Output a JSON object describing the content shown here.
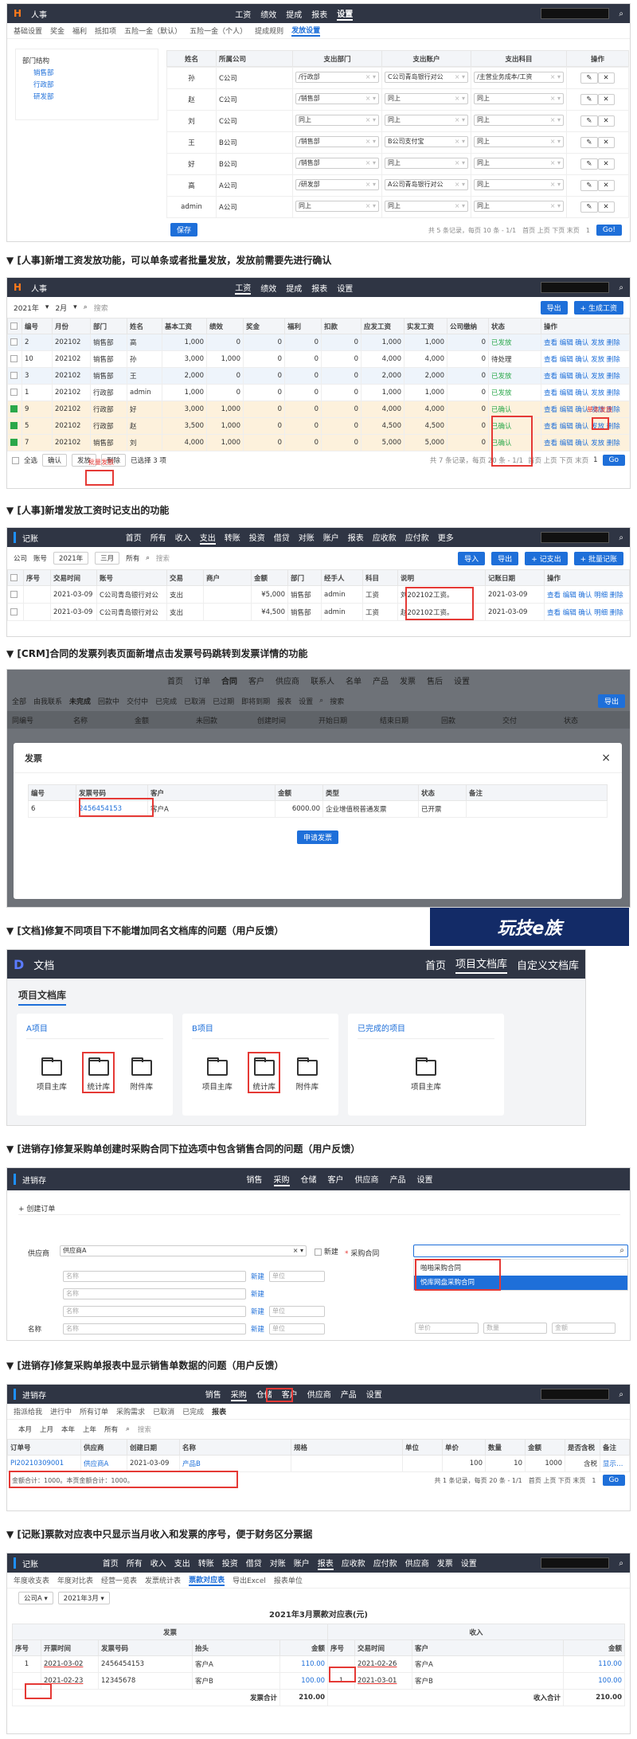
{
  "s1": {
    "logo": "H",
    "app": "人事",
    "nav": [
      "工资",
      "绩效",
      "提成",
      "报表",
      "设置"
    ],
    "nav_active": 4,
    "tabs": [
      "基础设置",
      "奖金",
      "福利",
      "抵扣项",
      "五险一金（默认）",
      "五险一金（个人）",
      "提成规则",
      "发放设置"
    ],
    "tab_active": 7,
    "tree_title": "部门结构",
    "tree": [
      "销售部",
      "行政部",
      "研发部"
    ],
    "cols": [
      "姓名",
      "所属公司",
      "支出部门",
      "支出账户",
      "支出科目",
      "操作"
    ],
    "rows": [
      [
        "孙",
        "C公司",
        "/行政部",
        "C公司青岛银行对公",
        "/主营业务成本/工资"
      ],
      [
        "赵",
        "C公司",
        "/销售部",
        "同上",
        "同上"
      ],
      [
        "刘",
        "C公司",
        "同上",
        "同上",
        "同上"
      ],
      [
        "王",
        "B公司",
        "/销售部",
        "B公司支付宝",
        "同上"
      ],
      [
        "好",
        "B公司",
        "/销售部",
        "同上",
        "同上"
      ],
      [
        "高",
        "A公司",
        "/研发部",
        "A公司青岛银行对公",
        "同上"
      ],
      [
        "admin",
        "A公司",
        "同上",
        "同上",
        "同上"
      ]
    ],
    "save": "保存",
    "pager": "共 5 条记录，每页 10 条 - 1/1",
    "pager2": "首页 上页 下页 末页",
    "page": "1",
    "go": "Go!"
  },
  "n1": "▼ [人事]新增工资发放功能，可以单条或者批量发放，发放前需要先进行确认",
  "s2": {
    "logo": "H",
    "app": "人事",
    "nav": [
      "工资",
      "绩效",
      "提成",
      "报表",
      "设置"
    ],
    "nav_active": 0,
    "year": "2021年",
    "month": "2月",
    "search": "搜索",
    "export": "导出",
    "gen": "+ 生成工资",
    "cols": [
      "编号",
      "月份",
      "部门",
      "姓名",
      "基本工资",
      "绩效",
      "奖金",
      "福利",
      "扣款",
      "应发工资",
      "实发工资",
      "公司缴纳",
      "状态",
      "操作"
    ],
    "rows": [
      [
        "2",
        "202102",
        "销售部",
        "高",
        "1,000",
        "0",
        "0",
        "0",
        "0",
        "1,000",
        "1,000",
        "0",
        "已发放"
      ],
      [
        "10",
        "202102",
        "销售部",
        "孙",
        "3,000",
        "1,000",
        "0",
        "0",
        "0",
        "4,000",
        "4,000",
        "0",
        "待处理"
      ],
      [
        "3",
        "202102",
        "销售部",
        "王",
        "2,000",
        "0",
        "0",
        "0",
        "0",
        "2,000",
        "2,000",
        "0",
        "已发放"
      ],
      [
        "1",
        "202102",
        "行政部",
        "admin",
        "1,000",
        "0",
        "0",
        "0",
        "0",
        "1,000",
        "1,000",
        "0",
        "已发放"
      ],
      [
        "9",
        "202102",
        "行政部",
        "好",
        "3,000",
        "1,000",
        "0",
        "0",
        "0",
        "4,000",
        "4,000",
        "0",
        "已确认"
      ],
      [
        "5",
        "202102",
        "行政部",
        "赵",
        "3,500",
        "1,000",
        "0",
        "0",
        "0",
        "4,500",
        "4,500",
        "0",
        "已确认"
      ],
      [
        "7",
        "202102",
        "销售部",
        "刘",
        "4,000",
        "1,000",
        "0",
        "0",
        "0",
        "5,000",
        "5,000",
        "0",
        "已确认"
      ]
    ],
    "ops": "查看 编辑 确认 发放 删除",
    "ops_paid": "查看 编辑 确认 发放 删除",
    "batch_all": "全选",
    "batch_confirm": "确认",
    "batch_pay": "发放",
    "batch_del": "删除",
    "selected": "已选择 3 项",
    "pay_note": "单条发放",
    "batch_note": "批量发放",
    "pager": "共 7 条记录，每页 20 条 - 1/1",
    "pager2": "首页 上页 下页 末页",
    "page": "1",
    "go": "Go"
  },
  "n2": "▼ [人事]新增发放工资时记支出的功能",
  "s3": {
    "app": "记账",
    "nav": [
      "首页",
      "所有",
      "收入",
      "支出",
      "转账",
      "投资",
      "借贷",
      "对账",
      "账户",
      "报表",
      "应收款",
      "应付款",
      "更多"
    ],
    "nav_active": 3,
    "filters": [
      "公司",
      "账号",
      "2021年",
      "三月",
      "所有"
    ],
    "search": "搜索",
    "import": "导入",
    "export": "导出",
    "add": "+ 记支出",
    "batch": "+ 批量记账",
    "cols": [
      "序号",
      "交易时间",
      "账号",
      "交易",
      "商户",
      "金额",
      "部门",
      "经手人",
      "科目",
      "说明",
      "记账日期",
      "操作"
    ],
    "rows": [
      [
        "2021-03-09",
        "C公司青岛银行对公",
        "支出",
        "",
        "¥5,000",
        "销售部",
        "admin",
        "工资",
        "刘202102工资。",
        "2021-03-09"
      ],
      [
        "2021-03-09",
        "C公司青岛银行对公",
        "支出",
        "",
        "¥4,500",
        "销售部",
        "admin",
        "工资",
        "赵202102工资。",
        "2021-03-09"
      ]
    ],
    "ops": "查看 编辑 确认 明细 删除"
  },
  "n3": "▼ [CRM]合同的发票列表页面新增点击发票号码跳转到发票详情的功能",
  "s4": {
    "nav": [
      "首页",
      "订单",
      "合同",
      "客户",
      "供应商",
      "联系人",
      "名单",
      "产品",
      "发票",
      "售后",
      "设置"
    ],
    "nav_active": 2,
    "filters": [
      "全部",
      "由我联系",
      "未完成",
      "回款中",
      "交付中",
      "已完成",
      "已取消",
      "已过期",
      "即将到期",
      "报表",
      "设置"
    ],
    "search": "搜索",
    "export": "导出",
    "bg_cols": [
      "同编号",
      "名称",
      "金额",
      "未回款",
      "创建时间",
      "开始日期",
      "结束日期",
      "回款",
      "交付",
      "状态"
    ],
    "modal_title": "发票",
    "mcols": [
      "编号",
      "发票号码",
      "客户",
      "金额",
      "类型",
      "状态",
      "备注"
    ],
    "mrow": [
      "6",
      "2456454153",
      "客户A",
      "6000.00",
      "企业增值税普通发票",
      "已开票",
      ""
    ],
    "apply": "申请发票"
  },
  "n4": "▼ [文档]修复不同项目下不能增加同名文档库的问题（用户反馈）",
  "banner": "玩技e族",
  "s5": {
    "app": "文档",
    "nav": [
      "首页",
      "项目文档库",
      "自定义文档库"
    ],
    "nav_active": 1,
    "title": "项目文档库",
    "cards": [
      {
        "name": "A项目",
        "libs": [
          "项目主库",
          "统计库",
          "附件库"
        ]
      },
      {
        "name": "B项目",
        "libs": [
          "项目主库",
          "统计库",
          "附件库"
        ]
      },
      {
        "name": "已完成的项目",
        "libs": [
          "项目主库"
        ]
      }
    ]
  },
  "n5": "▼ [进销存]修复采购单创建时采购合同下拉选项中包含销售合同的问题（用户反馈）",
  "s6": {
    "app": "进销存",
    "nav": [
      "销售",
      "采购",
      "仓储",
      "客户",
      "供应商",
      "产品",
      "设置"
    ],
    "nav_active": 1,
    "create": "+ 创建订单",
    "supplier_label": "供应商",
    "supplier_val": "供应商A",
    "new": "新建",
    "contract_label": "采购合同",
    "opts": [
      "啪啪采购合同",
      "悦库网盘采购合同"
    ],
    "name_label": "名称",
    "name_ph": "名称",
    "unit_ph": "单位",
    "qty_ph": "数量",
    "amount_ph": "金额",
    "price_ph": "单价"
  },
  "n6": "▼ [进销存]修复采购单报表中显示销售单数据的问题（用户反馈）",
  "s7": {
    "app": "进销存",
    "nav": [
      "销售",
      "采购",
      "仓储",
      "客户",
      "供应商",
      "产品",
      "设置"
    ],
    "nav_active": 1,
    "filters": [
      "指派给我",
      "进行中",
      "所有订单",
      "采购需求",
      "已取消",
      "已完成",
      "报表"
    ],
    "filter_active": 6,
    "periods": [
      "本月",
      "上月",
      "本年",
      "上年",
      "所有"
    ],
    "search": "搜索",
    "cols": [
      "订单号",
      "供应商",
      "创建日期",
      "名称",
      "规格",
      "单位",
      "单价",
      "数量",
      "金额",
      "是否含税",
      "备注"
    ],
    "row": [
      "PI20210309001",
      "供应商A",
      "2021-03-09",
      "产品B",
      "",
      "",
      "100",
      "10",
      "1000",
      "含税",
      "显示备注"
    ],
    "total": "金额合计：1000。本页金额合计：1000。",
    "pager": "共 1 条记录，每页 20 条 - 1/1",
    "pager2": "首页 上页 下页 末页",
    "page": "1",
    "go": "Go"
  },
  "n7": "▼ [记账]票款对应表中只显示当月收入和发票的序号，便于财务区分票据",
  "s8": {
    "app": "记账",
    "nav": [
      "首页",
      "所有",
      "收入",
      "支出",
      "转账",
      "投资",
      "借贷",
      "对账",
      "账户",
      "报表",
      "应收款",
      "应付款",
      "供应商",
      "发票",
      "设置"
    ],
    "nav_active": 9,
    "tabs": [
      "年度收支表",
      "年度对比表",
      "经营一览表",
      "发票统计表",
      "票款对应表",
      "导出Excel",
      "报表单位"
    ],
    "tab_active": 4,
    "company": "公司A",
    "month": "2021年3月",
    "title": "2021年3月票款对应表(元)",
    "g1": "发票",
    "g2": "收入",
    "cols": [
      "序号",
      "开票时间",
      "发票号码",
      "抬头",
      "金额",
      "序号",
      "交易时间",
      "客户",
      "金额"
    ],
    "rows": [
      [
        "1",
        "2021-03-02",
        "2456454153",
        "客户A",
        "110.00",
        "",
        "2021-02-26",
        "客户A",
        "110.00"
      ],
      [
        "",
        "2021-02-23",
        "12345678",
        "客户B",
        "100.00",
        "1",
        "2021-03-01",
        "客户B",
        "100.00"
      ]
    ],
    "sum_left": "发票合计",
    "sum_left_v": "210.00",
    "sum_right": "收入合计",
    "sum_right_v": "210.00"
  }
}
